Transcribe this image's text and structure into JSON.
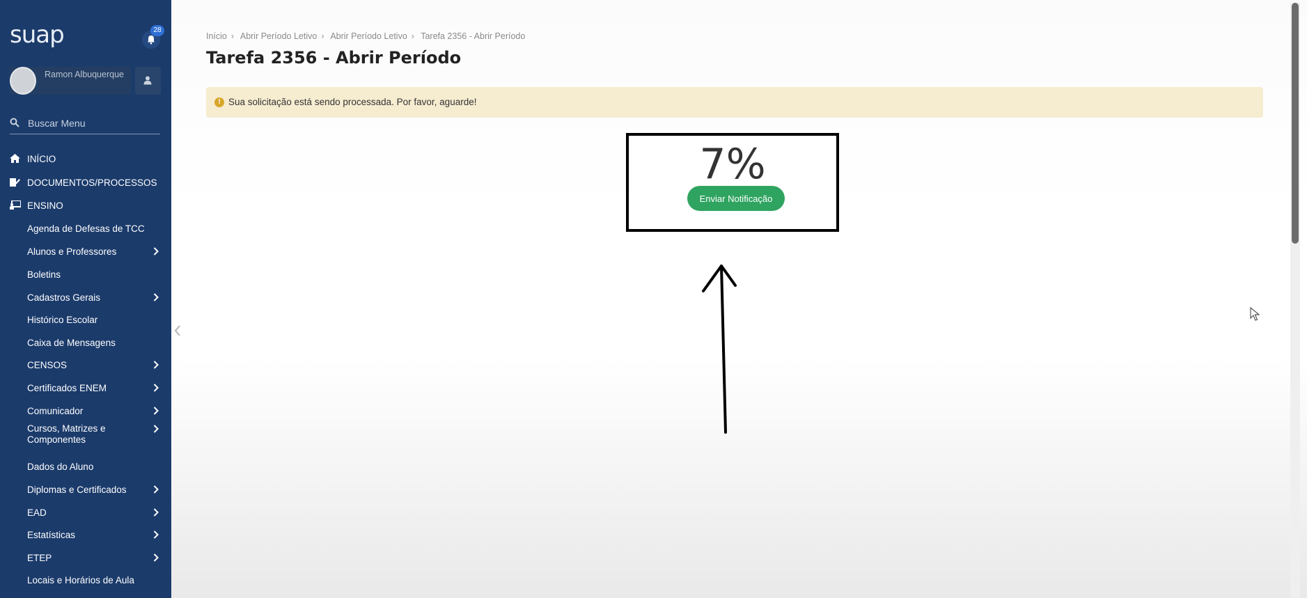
{
  "app": {
    "logo": "suap",
    "notifications": "28"
  },
  "user": {
    "name": "Ramon Albuquerque"
  },
  "search": {
    "placeholder": "Buscar Menu"
  },
  "nav": {
    "top": [
      {
        "label": "INÍCIO",
        "icon": "home-icon"
      },
      {
        "label": "DOCUMENTOS/PROCESSOS",
        "icon": "document-edit-icon"
      },
      {
        "label": "ENSINO",
        "icon": "teaching-icon"
      }
    ],
    "ensino_items": [
      {
        "label": "Agenda de Defesas de TCC",
        "sub": false
      },
      {
        "label": "Alunos e Professores",
        "sub": true
      },
      {
        "label": "Boletins",
        "sub": false
      },
      {
        "label": "Cadastros Gerais",
        "sub": true
      },
      {
        "label": "Histórico Escolar",
        "sub": false
      },
      {
        "label": "Caixa de Mensagens",
        "sub": false
      },
      {
        "label": "CENSOS",
        "sub": true
      },
      {
        "label": "Certificados ENEM",
        "sub": true
      },
      {
        "label": "Comunicador",
        "sub": true
      },
      {
        "label": "Cursos, Matrizes e Componentes",
        "sub": true
      },
      {
        "label": "Dados do Aluno",
        "sub": false
      },
      {
        "label": "Diplomas e Certificados",
        "sub": true
      },
      {
        "label": "EAD",
        "sub": true
      },
      {
        "label": "Estatísticas",
        "sub": true
      },
      {
        "label": "ETEP",
        "sub": true
      },
      {
        "label": "Locais e Horários de Aula",
        "sub": false
      }
    ]
  },
  "breadcrumb": [
    "Início",
    "Abrir Período Letivo",
    "Abrir Período Letivo",
    "Tarefa 2356 - Abrir Período"
  ],
  "page": {
    "title": "Tarefa 2356 - Abrir Período"
  },
  "alert": {
    "text": "Sua solicitação está sendo processada. Por favor, aguarde!"
  },
  "progress": {
    "percent_label": "7%",
    "percent": 7
  },
  "actions": {
    "notify_label": "Enviar Notificação"
  },
  "colors": {
    "sidebar": "#1b3b6b",
    "accent_green": "#2fa460",
    "alert_bg": "#f6ecd0"
  }
}
